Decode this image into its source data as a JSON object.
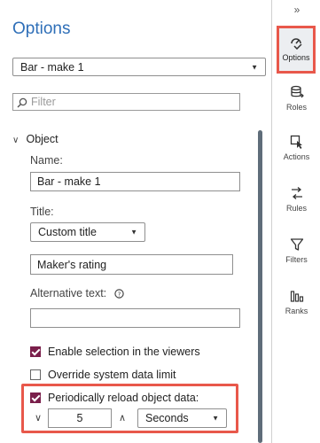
{
  "panel": {
    "title": "Options",
    "object_selector": {
      "value": "Bar - make 1"
    },
    "filter": {
      "placeholder": "Filter",
      "value": ""
    },
    "section": {
      "label": "Object",
      "name_label": "Name:",
      "name_value": "Bar - make 1",
      "title_label": "Title:",
      "title_mode": "Custom title",
      "title_value": "Maker's rating",
      "alt_text_label": "Alternative text:",
      "alt_text_value": "",
      "enable_selection": {
        "label": "Enable selection in the viewers",
        "checked": true
      },
      "override_limit": {
        "label": "Override system data limit",
        "checked": false
      },
      "reload": {
        "label": "Periodically reload object data:",
        "checked": true,
        "interval_value": "5",
        "unit": "Seconds"
      }
    }
  },
  "rail": {
    "collapse_glyph": "»",
    "items": [
      {
        "label": "Options",
        "icon": "options-icon",
        "active": true
      },
      {
        "label": "Roles",
        "icon": "roles-icon",
        "active": false
      },
      {
        "label": "Actions",
        "icon": "actions-icon",
        "active": false
      },
      {
        "label": "Rules",
        "icon": "rules-icon",
        "active": false
      },
      {
        "label": "Filters",
        "icon": "filter-icon",
        "active": false
      },
      {
        "label": "Ranks",
        "icon": "ranks-icon",
        "active": false
      }
    ]
  },
  "colors": {
    "title_blue": "#2f6fb8",
    "checkbox_checked": "#7a1f4b",
    "highlight_red": "#e8584b",
    "scrollbar": "#5f6d7a"
  }
}
